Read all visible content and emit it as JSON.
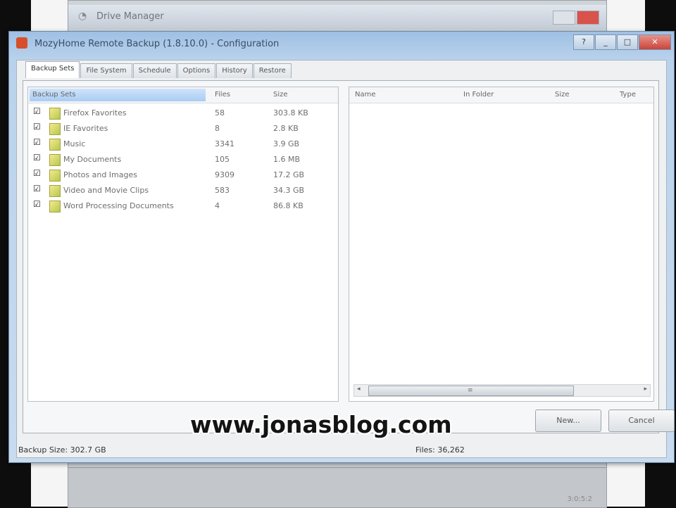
{
  "background_window": {
    "title": "Drive Manager",
    "footer_text": "3:0:5:2"
  },
  "window": {
    "title": "MozyHome Remote Backup (1.8.10.0) - Configuration",
    "help_label": "?",
    "minimize_label": "_",
    "maximize_label": "□",
    "close_label": "✕"
  },
  "tabs": [
    {
      "label": "Backup Sets",
      "active": true
    },
    {
      "label": "File System",
      "active": false
    },
    {
      "label": "Schedule",
      "active": false
    },
    {
      "label": "Options",
      "active": false
    },
    {
      "label": "History",
      "active": false
    },
    {
      "label": "Restore",
      "active": false
    }
  ],
  "backup_sets": {
    "headers": {
      "name": "Backup Sets",
      "files": "Files",
      "size": "Size"
    },
    "rows": [
      {
        "checked": true,
        "name": "Firefox Favorites",
        "files": "58",
        "size": "303.8 KB"
      },
      {
        "checked": true,
        "name": "IE Favorites",
        "files": "8",
        "size": "2.8 KB"
      },
      {
        "checked": true,
        "name": "Music",
        "files": "3341",
        "size": "3.9 GB"
      },
      {
        "checked": true,
        "name": "My Documents",
        "files": "105",
        "size": "1.6 MB"
      },
      {
        "checked": true,
        "name": "Photos and Images",
        "files": "9309",
        "size": "17.2 GB"
      },
      {
        "checked": true,
        "name": "Video and Movie Clips",
        "files": "583",
        "size": "34.3 GB"
      },
      {
        "checked": true,
        "name": "Word Processing Documents",
        "files": "4",
        "size": "86.8 KB"
      }
    ]
  },
  "details": {
    "headers": {
      "name": "Name",
      "folder": "In Folder",
      "size": "Size",
      "type": "Type"
    }
  },
  "buttons": {
    "new_label": "New...",
    "cancel_label": "Cancel"
  },
  "status": {
    "backup_size": "Backup Size: 302.7 GB",
    "files": "Files: 36,262"
  },
  "watermark": "www.jonasblog.com"
}
